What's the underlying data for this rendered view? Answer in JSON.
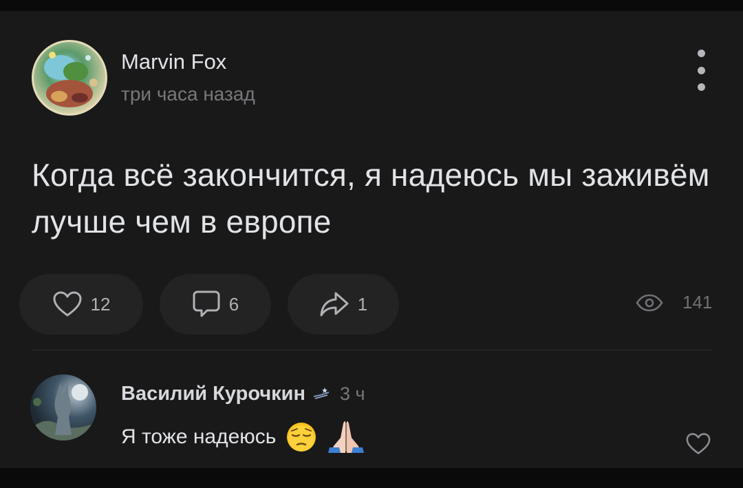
{
  "post": {
    "author_name": "Marvin Fox",
    "time": "три часа назад",
    "text": "Когда всё закончится, я надеюсь мы заживём лучше чем в европе",
    "likes": "12",
    "comments": "6",
    "shares": "1",
    "views": "141"
  },
  "comment": {
    "author_name": "Василий Курочкин",
    "time": "3 ч",
    "text": "Я тоже надеюсь"
  },
  "icons": {
    "more": "more-vertical-icon",
    "like": "heart-icon",
    "comment": "comment-icon",
    "share": "share-icon",
    "views": "eye-icon"
  },
  "colors": {
    "background": "#19191a",
    "pill": "#232324",
    "text_primary": "#e1e3e6",
    "text_secondary": "#76787a"
  }
}
